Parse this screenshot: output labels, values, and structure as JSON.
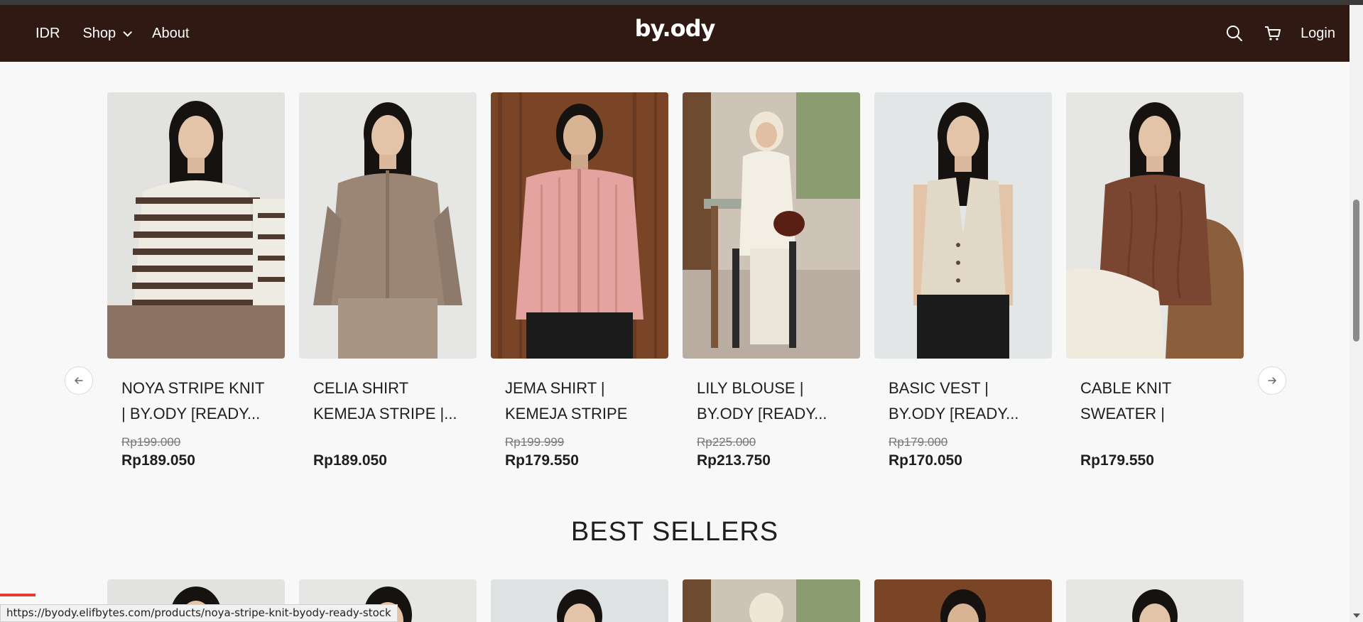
{
  "header": {
    "currency": "IDR",
    "shop_label": "Shop",
    "about_label": "About",
    "logo_text": "by.ody",
    "login_label": "Login"
  },
  "products": [
    {
      "name": "NOYA STRIPE KNIT | BY.ODY [READY...",
      "old_price": "Rp199.000",
      "price": "Rp189.050"
    },
    {
      "name": "CELIA SHIRT KEMEJA STRIPE |...",
      "old_price": "",
      "price": "Rp189.050"
    },
    {
      "name": "JEMA SHIRT | KEMEJA STRIPE BY...",
      "old_price": "Rp199.999",
      "price": "Rp179.550"
    },
    {
      "name": "LILY BLOUSE | BY.ODY [READY...",
      "old_price": "Rp225.000",
      "price": "Rp213.750"
    },
    {
      "name": "BASIC VEST | BY.ODY [READY...",
      "old_price": "Rp179.000",
      "price": "Rp170.050"
    },
    {
      "name": "CABLE KNIT SWEATER | BY.ODY...",
      "old_price": "",
      "price": "Rp179.550"
    }
  ],
  "best_sellers": {
    "title": "BEST SELLERS"
  },
  "status_bar": {
    "url": "https://byody.elifbytes.com/products/noya-stripe-knit-byody-ready-stock"
  },
  "colors": {
    "header_bg": "#2f1912",
    "page_bg": "#f8f8f8"
  }
}
